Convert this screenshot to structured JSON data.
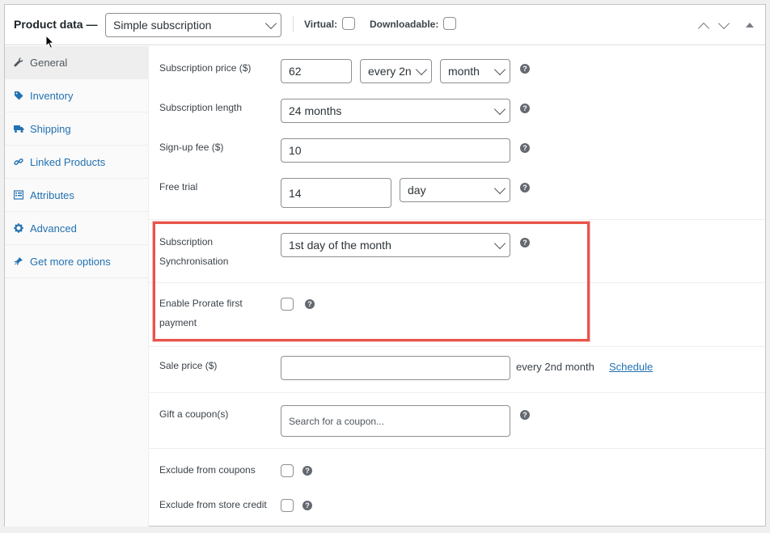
{
  "header": {
    "title": "Product data —",
    "product_type": "Simple subscription",
    "virtual_label": "Virtual:",
    "downloadable_label": "Downloadable:"
  },
  "sidebar": {
    "items": [
      {
        "label": "General",
        "icon": "wrench-icon",
        "active": true
      },
      {
        "label": "Inventory",
        "icon": "tag-icon"
      },
      {
        "label": "Shipping",
        "icon": "truck-icon"
      },
      {
        "label": "Linked Products",
        "icon": "link-icon"
      },
      {
        "label": "Attributes",
        "icon": "list-icon"
      },
      {
        "label": "Advanced",
        "icon": "gear-icon"
      },
      {
        "label": "Get more options",
        "icon": "plugin-icon"
      }
    ]
  },
  "form": {
    "subscription_price": {
      "label": "Subscription price ($)",
      "value": "62",
      "interval": "every 2n",
      "period": "month"
    },
    "subscription_length": {
      "label": "Subscription length",
      "value": "24 months"
    },
    "signup_fee": {
      "label": "Sign-up fee ($)",
      "value": "10"
    },
    "free_trial": {
      "label": "Free trial",
      "value": "14",
      "period": "day"
    },
    "sync": {
      "label_line1": "Subscription",
      "label_line2": "Synchronisation",
      "value": "1st day of the month"
    },
    "prorate": {
      "label_line1": "Enable Prorate first",
      "label_line2": "payment"
    },
    "sale_price": {
      "label": "Sale price ($)",
      "value": "",
      "suffix": "every 2nd month",
      "schedule_link": "Schedule"
    },
    "gift_coupon": {
      "label": "Gift a coupon(s)",
      "placeholder": "Search for a coupon..."
    },
    "exclude_coupons": {
      "label": "Exclude from coupons"
    },
    "exclude_store_credit": {
      "label": "Exclude from store credit"
    }
  },
  "help_glyph": "?",
  "colors": {
    "link": "#2271b1",
    "highlight": "#e8544a"
  }
}
